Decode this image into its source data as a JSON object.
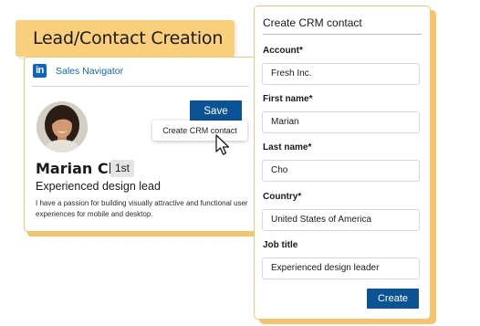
{
  "banner": {
    "title": "Lead/Contact Creation"
  },
  "sales_nav": {
    "logo_text": "in",
    "title": "Sales Navigator",
    "save_label": "Save",
    "menu_item": "Create CRM contact",
    "profile": {
      "name": "Marian Cho",
      "degree": "1st",
      "headline": "Experienced design lead",
      "about": "I have a passion for building visually attractive and functional user experiences for mobile and desktop."
    }
  },
  "crm_form": {
    "title": "Create CRM contact",
    "fields": [
      {
        "label": "Account*",
        "value": "Fresh Inc."
      },
      {
        "label": "First name*",
        "value": "Marian"
      },
      {
        "label": "Last name*",
        "value": "Cho"
      },
      {
        "label": "Country*",
        "value": "United States of America"
      },
      {
        "label": "Job title",
        "value": "Experienced design leader"
      }
    ],
    "submit_label": "Create"
  },
  "colors": {
    "accent_yellow": "#f9cf7c",
    "border_yellow": "#f3c46e",
    "linkedin_blue": "#0a66c2",
    "button_blue": "#0b5394"
  }
}
